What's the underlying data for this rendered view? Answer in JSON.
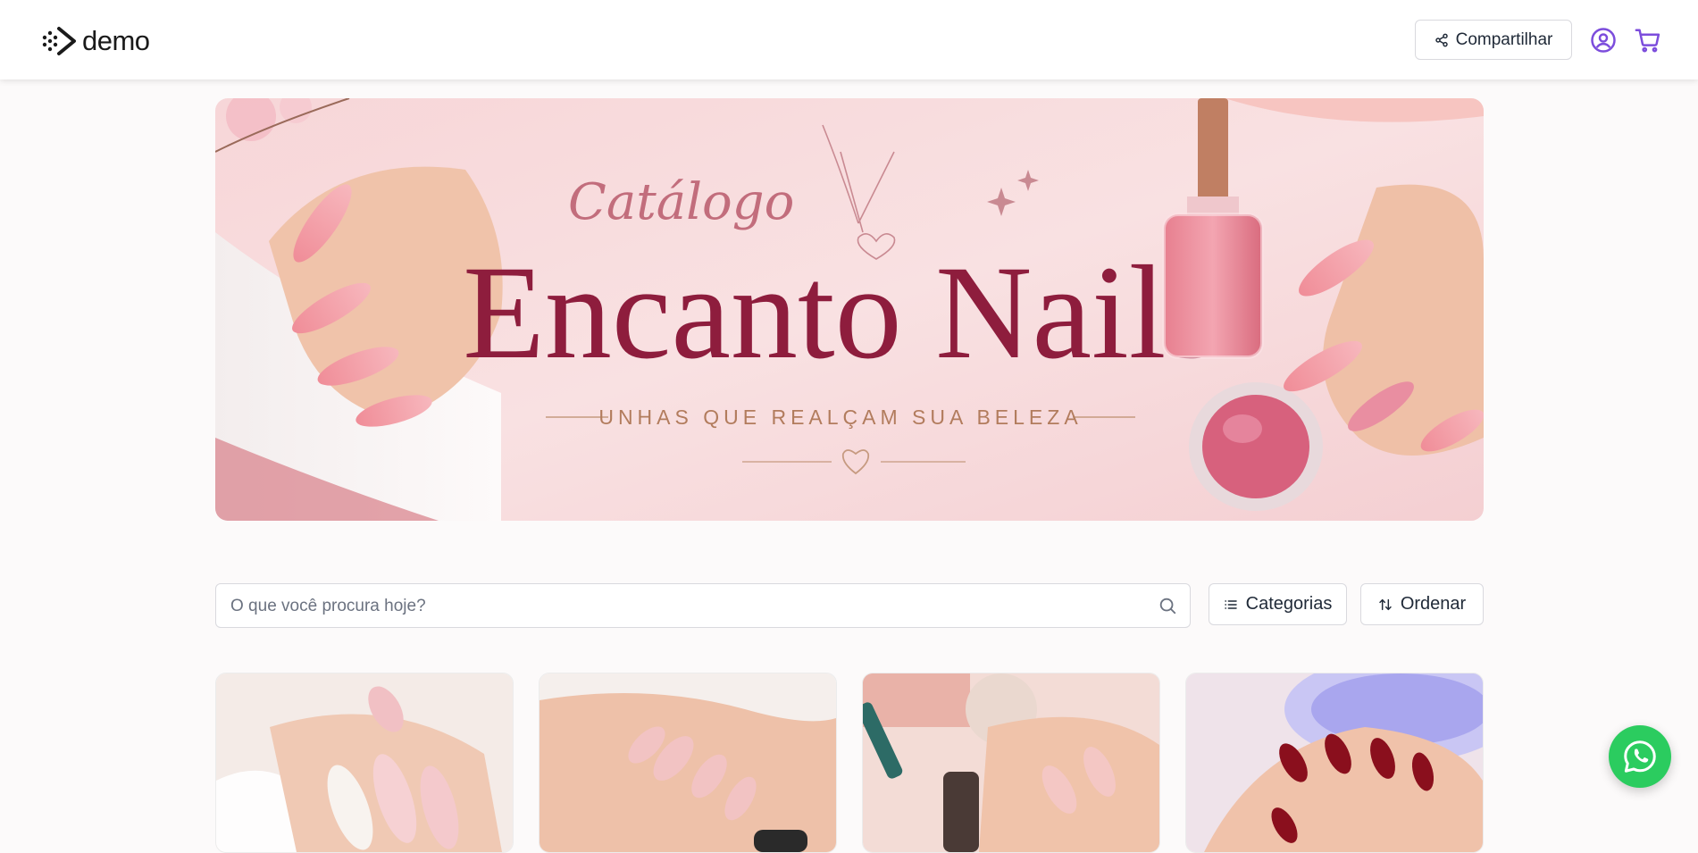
{
  "header": {
    "logo_text": "demo",
    "share_label": "Compartilhar",
    "icons": [
      "share-icon",
      "user-icon",
      "cart-icon"
    ],
    "accent_color": "#7c4ddc"
  },
  "banner": {
    "script_title": "Catálogo",
    "title": "Encanto Nails",
    "tagline": "UNHAS QUE REALÇAM SUA BELEZA"
  },
  "search": {
    "placeholder": "O que você procura hoje?",
    "value": ""
  },
  "filters": {
    "categories_label": "Categorias",
    "sort_label": "Ordenar"
  },
  "products": [
    {
      "image": "nude-almond-nails"
    },
    {
      "image": "natural-pink-nails"
    },
    {
      "image": "nail-oil-application"
    },
    {
      "image": "burgundy-nails-uv-lamp"
    }
  ],
  "whatsapp": {
    "icon": "whatsapp-icon",
    "color": "#2bcc5f"
  }
}
